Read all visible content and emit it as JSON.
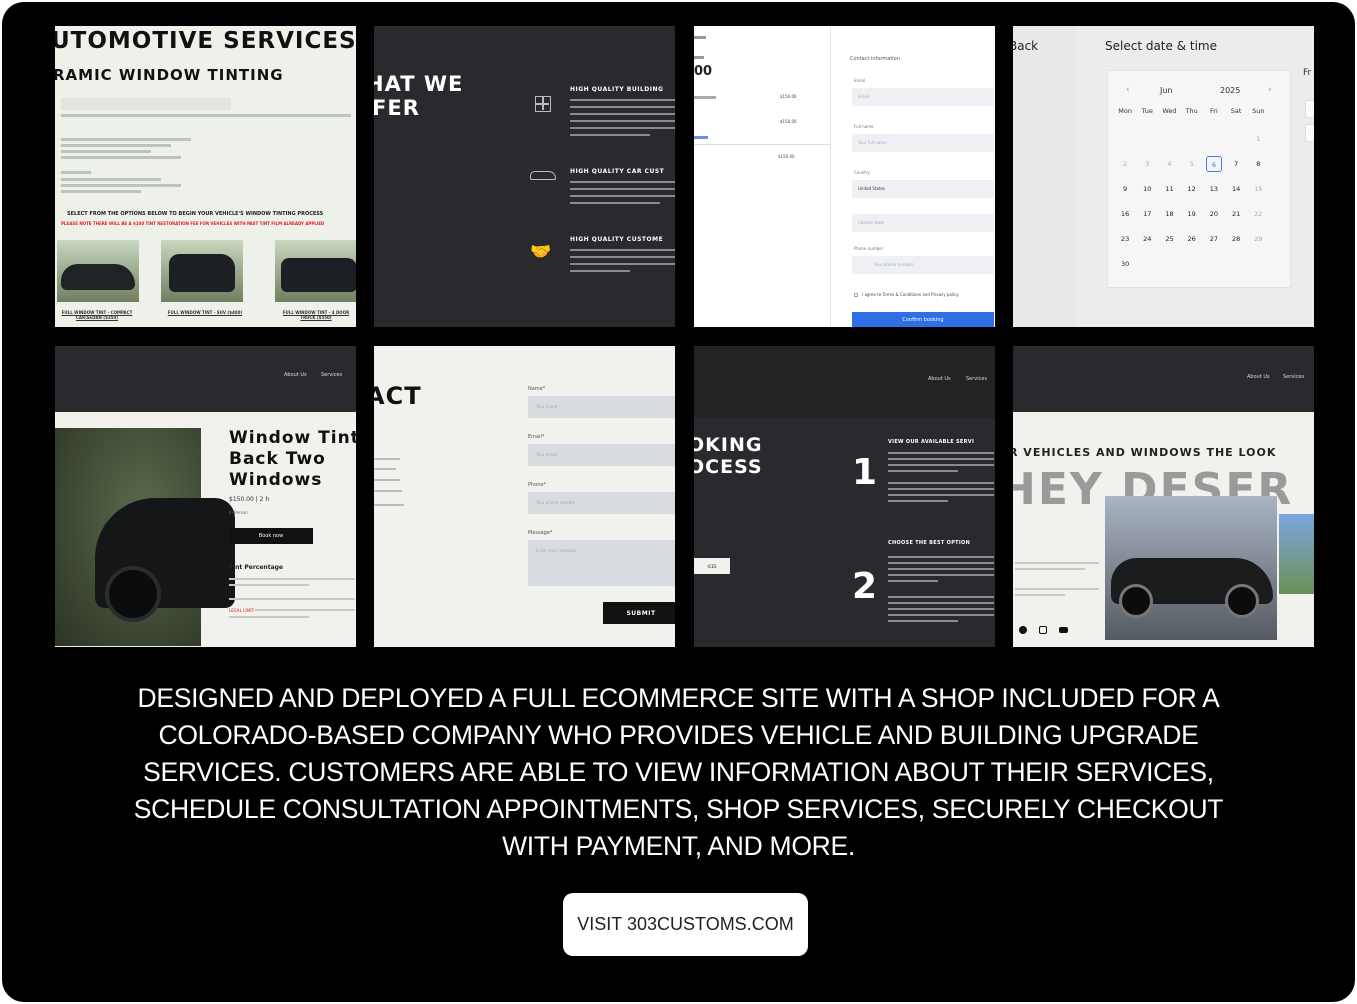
{
  "tiles": {
    "t1": {
      "title": "UTOMOTIVE SERVICES",
      "subtitle": "RAMIC WINDOW TINTING",
      "instruction": "SELECT FROM THE OPTIONS BELOW TO BEGIN YOUR VEHICLE'S WINDOW TINTING PROCESS",
      "notice": "PLEASE NOTE THERE WILL BE A $100 TINT RESTORATION FEE FOR VEHICLES WITH PAST TINT FILM ALREADY APPLIED",
      "products": [
        "FULL WINDOW TINT - COMPACT CAR/SEDAN ($350)",
        "FULL WINDOW TINT - SUV ($400)",
        "FULL WINDOW TINT - 4 DOOR TRUCK ($550)"
      ]
    },
    "t2": {
      "heading_1": "HAT WE",
      "heading_2": "FER",
      "features": [
        {
          "title": "HIGH QUALITY BUILDING",
          "icon": "building-window-icon"
        },
        {
          "title": "HIGH QUALITY CAR CUST",
          "icon": "car-icon"
        },
        {
          "title": "HIGH QUALITY CUSTOME",
          "icon": "handshake-icon"
        }
      ]
    },
    "t3": {
      "price_big": "00",
      "prices": [
        "$150.00",
        "$150.00",
        "$150.00"
      ],
      "contact_title": "Contact information",
      "email_label": "Email",
      "email_placeholder": "Email",
      "fullname_label": "Full name",
      "fullname_placeholder": "Your full name",
      "country_label": "Country",
      "country_value": "United States",
      "state_placeholder": "Choose state",
      "phone_label": "Phone number",
      "phone_placeholder": "Your phone number",
      "terms_text": "I agree to Terms & Conditions and Privacy policy",
      "confirm_label": "Confirm booking"
    },
    "t4": {
      "back_label": "Back",
      "title": "Select date & time",
      "month": "Jun",
      "year": "2025",
      "weekdays": [
        "Mon",
        "Tue",
        "Wed",
        "Thu",
        "Fri",
        "Sat",
        "Sun"
      ],
      "weeks": [
        [
          "",
          "",
          "",
          "",
          "",
          "",
          "1"
        ],
        [
          "2",
          "3",
          "4",
          "5",
          "6",
          "7",
          "8"
        ],
        [
          "9",
          "10",
          "11",
          "12",
          "13",
          "14",
          "15"
        ],
        [
          "16",
          "17",
          "18",
          "19",
          "20",
          "21",
          "22"
        ],
        [
          "23",
          "24",
          "25",
          "26",
          "27",
          "28",
          "29"
        ],
        [
          "30",
          "",
          "",
          "",
          "",
          "",
          ""
        ]
      ],
      "selected_day": "6",
      "side_label": "Fr"
    },
    "t5": {
      "nav": [
        "About Us",
        "Services"
      ],
      "product_title": "Window Tint Back Two Windows",
      "price_line": "$150.00 | 2 h",
      "location": "In-Person",
      "book_label": "Book now",
      "section_title": "Tint Percentage",
      "legal_label": "LEGAL LIMIT:"
    },
    "t6": {
      "heading": "ACT",
      "name_label": "Name*",
      "name_placeholder": "Your name",
      "email_label": "Email*",
      "email_placeholder": "Your email",
      "phone_label": "Phone*",
      "phone_placeholder": "Your phone number",
      "message_label": "Message*",
      "message_placeholder": "Enter your message",
      "submit_label": "SUBMIT"
    },
    "t7": {
      "nav": [
        "About Us",
        "Services"
      ],
      "heading_1": "OKING",
      "heading_2": "OCESS",
      "steps": [
        {
          "num": "1",
          "title": "VIEW OUR AVAILABLE SERVI"
        },
        {
          "num": "2",
          "title": "CHOOSE THE BEST OPTION"
        }
      ],
      "button": "ICES"
    },
    "t8": {
      "nav": [
        "About Us",
        "Services"
      ],
      "headline": "R VEHICLES AND WINDOWS THE LOOK",
      "big_text": "HEY DESER",
      "social_icons": [
        "facebook-icon",
        "instagram-icon",
        "youtube-icon"
      ]
    }
  },
  "caption": "DESIGNED AND DEPLOYED A FULL ECOMMERCE SITE WITH A SHOP INCLUDED FOR A COLORADO-BASED COMPANY WHO PROVIDES VEHICLE AND BUILDING UPGRADE SERVICES. CUSTOMERS ARE ABLE TO VIEW INFORMATION ABOUT THEIR SERVICES, SCHEDULE CONSULTATION APPOINTMENTS, SHOP SERVICES, SECURELY CHECKOUT WITH PAYMENT, AND MORE.",
  "cta_label": "VISIT 303CUSTOMS.COM",
  "colors": {
    "background": "#000000",
    "accent_blue": "#2f6fe4",
    "dark_panel": "#2a2a2e",
    "light_panel": "#f1f1ee"
  }
}
